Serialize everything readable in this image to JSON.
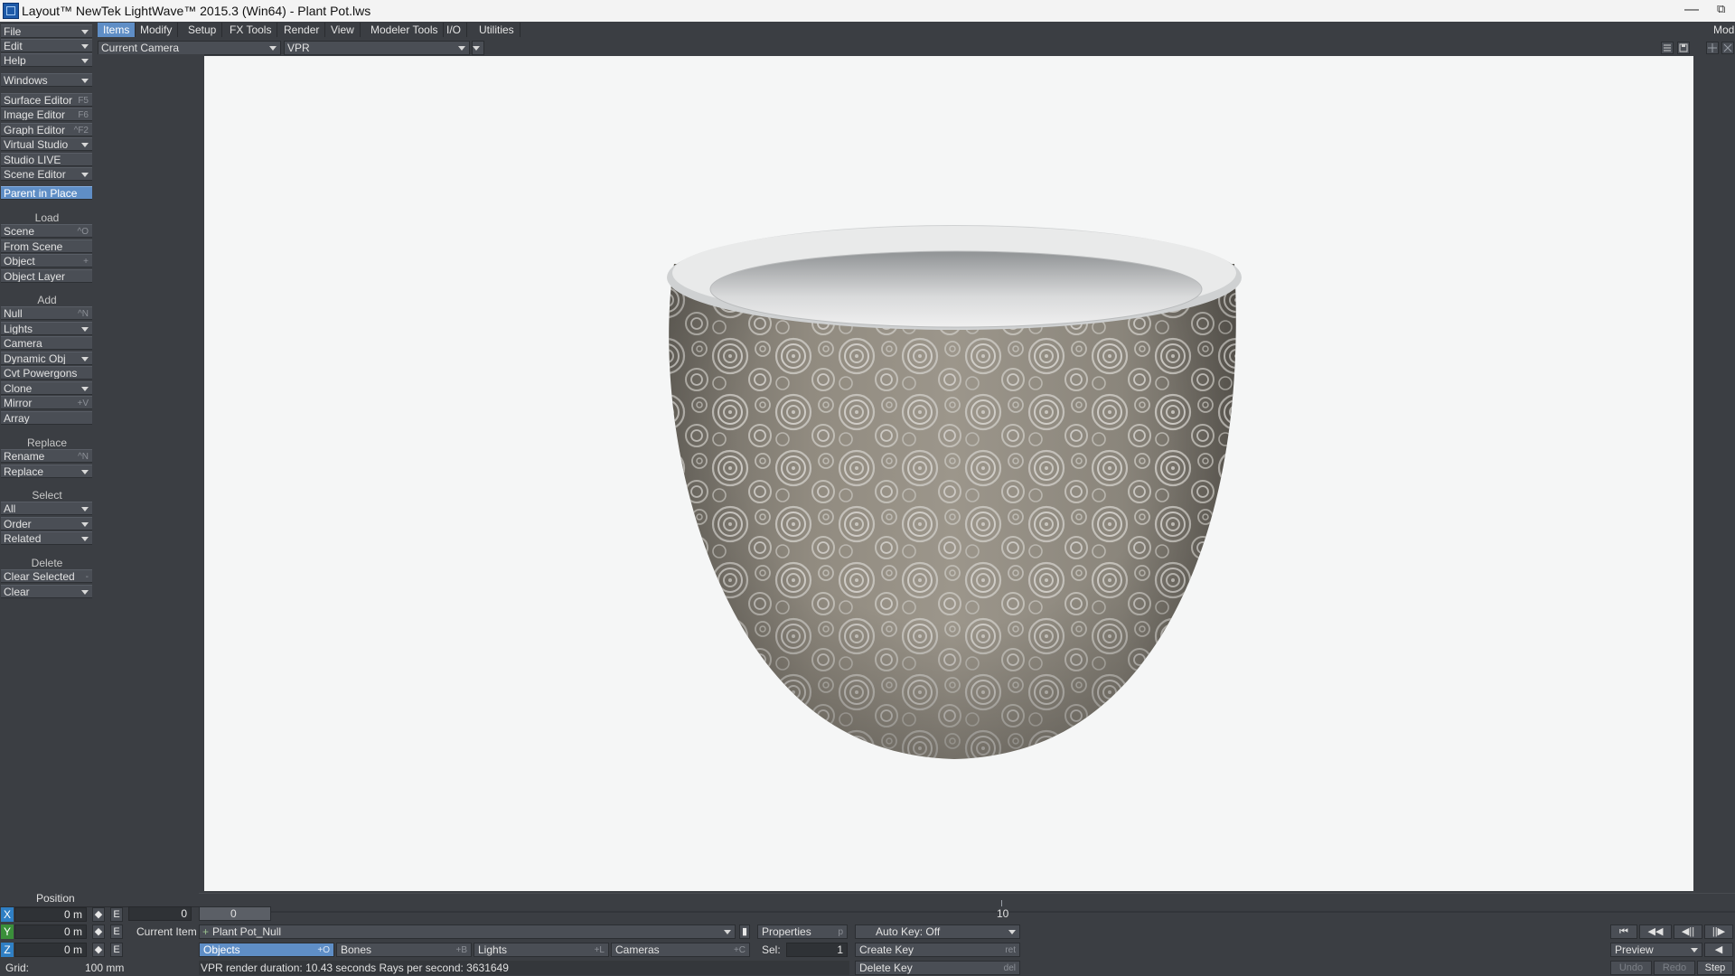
{
  "window": {
    "title": "Layout™ NewTek LightWave™ 2015.3 (Win64) - Plant Pot.lws",
    "minimize_glyph": "—",
    "restore_glyph": "⧉"
  },
  "sidebar": {
    "file": "File",
    "edit": "Edit",
    "help": "Help",
    "windows": "Windows",
    "surface_editor": "Surface Editor",
    "surface_editor_sc": "F5",
    "image_editor": "Image Editor",
    "image_editor_sc": "F6",
    "graph_editor": "Graph Editor",
    "graph_editor_sc": "^F2",
    "virtual_studio": "Virtual Studio",
    "studio_live": "Studio LIVE",
    "scene_editor": "Scene Editor",
    "parent_in_place": "Parent in Place",
    "load_header": "Load",
    "scene": "Scene",
    "scene_sc": "^O",
    "from_scene": "From Scene",
    "object": "Object",
    "object_sc": "+",
    "object_layer": "Object Layer",
    "add_header": "Add",
    "null": "Null",
    "null_sc": "^N",
    "lights": "Lights",
    "camera": "Camera",
    "dynamic_obj": "Dynamic Obj",
    "cvt_powergons": "Cvt Powergons",
    "clone": "Clone",
    "mirror": "Mirror",
    "mirror_sc": "+V",
    "array": "Array",
    "replace_header": "Replace",
    "rename": "Rename",
    "rename_sc": "^N",
    "replace": "Replace",
    "select_header": "Select",
    "all": "All",
    "order": "Order",
    "related": "Related",
    "delete_header": "Delete",
    "clear_selected": "Clear Selected",
    "clear_selected_sc": "-",
    "clear": "Clear"
  },
  "tabs": [
    "Items",
    "Modify",
    "Setup",
    "FX Tools",
    "Render",
    "View",
    "Modeler Tools",
    "I/O",
    "Utilities"
  ],
  "top_right": {
    "mod_label": "Mod"
  },
  "viewport": {
    "camera_select": "Current Camera",
    "render_mode": "VPR"
  },
  "position_panel": {
    "heading": "Position",
    "x_label": "X",
    "x_value": "0 m",
    "y_label": "Y",
    "y_value": "0 m",
    "z_label": "Z",
    "z_value": "0 m",
    "env_label": "E",
    "grid_label": "Grid:",
    "grid_value": "100 mm"
  },
  "timeline": {
    "current_frame": "0",
    "slider_frame": "0",
    "tick_10": "10"
  },
  "item_row": {
    "current_item_label": "Current Item",
    "current_item_value": "Plant Pot_Null",
    "properties": "Properties",
    "properties_sc": "p",
    "auto_key": "Auto Key: Off"
  },
  "filters": {
    "objects": "Objects",
    "objects_sc": "+O",
    "bones": "Bones",
    "bones_sc": "+B",
    "lights": "Lights",
    "lights_sc": "+L",
    "cameras": "Cameras",
    "cameras_sc": "+C",
    "sel_label": "Sel:",
    "sel_value": "1"
  },
  "keys": {
    "create_key": "Create Key",
    "create_key_sc": "ret",
    "delete_key": "Delete Key",
    "delete_key_sc": "del"
  },
  "status": {
    "message": "VPR render duration: 10.43 seconds  Rays per second: 3631649"
  },
  "transport": {
    "preview": "Preview",
    "undo": "Undo",
    "redo": "Redo",
    "step": "Step"
  },
  "colors": {
    "accent": "#5f8ec6",
    "panel_bg": "#3b3e43",
    "viewport_bg": "#f5f6f6"
  }
}
